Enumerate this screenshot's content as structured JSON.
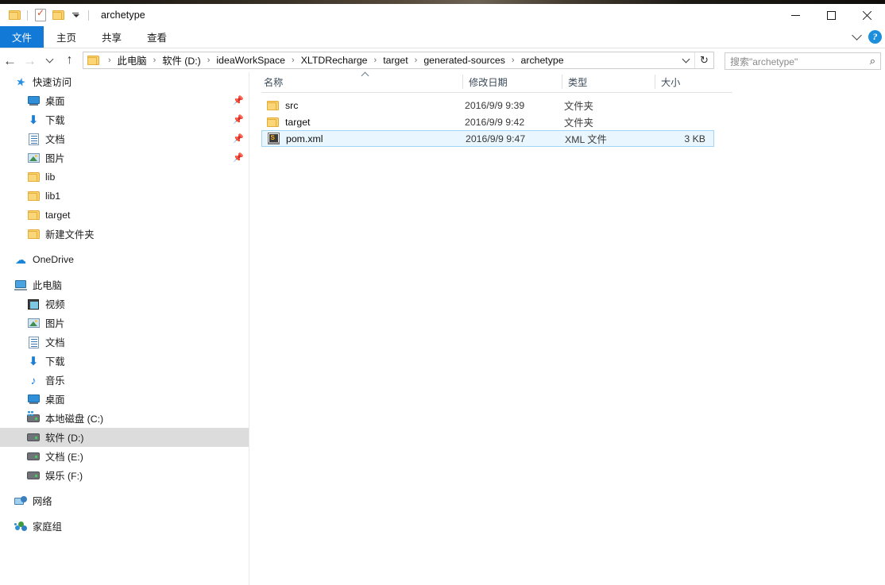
{
  "window": {
    "title": "archetype",
    "quick_access": [
      "folder-icon",
      "properties-checkdoc-icon",
      "new-folder-icon",
      "customize-dropdown-icon"
    ],
    "controls": {
      "minimize": "minimize-icon",
      "maximize": "maximize-icon",
      "close": "close-icon"
    }
  },
  "ribbon": {
    "tabs": [
      {
        "label": "文件",
        "active": true
      },
      {
        "label": "主页",
        "active": false
      },
      {
        "label": "共享",
        "active": false
      },
      {
        "label": "查看",
        "active": false
      }
    ],
    "collapse_icon": "chevron-down-icon",
    "help_icon": "help-icon",
    "help_glyph": "?"
  },
  "address": {
    "back_glyph": "←",
    "forward_glyph": "→",
    "recent_glyph": "recent-locations-icon",
    "up_glyph": "↑",
    "separator": "›",
    "breadcrumbs": [
      "此电脑",
      "软件 (D:)",
      "ideaWorkSpace",
      "XLTDRecharge",
      "target",
      "generated-sources",
      "archetype"
    ],
    "dropdown_icon": "address-dropdown-icon",
    "refresh_glyph": "↻"
  },
  "search": {
    "placeholder": "搜索\"archetype\"",
    "icon_glyph": "⌕"
  },
  "sidebar": {
    "items": [
      {
        "label": "快速访问",
        "icon": "star-pin-icon",
        "indent": 0,
        "pinned": false,
        "selected": false,
        "group": true
      },
      {
        "label": "桌面",
        "icon": "desktop-icon",
        "indent": 1,
        "pinned": true,
        "selected": false
      },
      {
        "label": "下载",
        "icon": "download-icon",
        "indent": 1,
        "pinned": true,
        "selected": false
      },
      {
        "label": "文档",
        "icon": "document-icon",
        "indent": 1,
        "pinned": true,
        "selected": false
      },
      {
        "label": "图片",
        "icon": "pictures-icon",
        "indent": 1,
        "pinned": true,
        "selected": false
      },
      {
        "label": "lib",
        "icon": "folder-icon",
        "indent": 1,
        "pinned": false,
        "selected": false
      },
      {
        "label": "lib1",
        "icon": "folder-icon",
        "indent": 1,
        "pinned": false,
        "selected": false
      },
      {
        "label": "target",
        "icon": "folder-icon",
        "indent": 1,
        "pinned": false,
        "selected": false
      },
      {
        "label": "新建文件夹",
        "icon": "folder-icon",
        "indent": 1,
        "pinned": false,
        "selected": false
      },
      {
        "label": "OneDrive",
        "icon": "onedrive-cloud-icon",
        "indent": 0,
        "pinned": false,
        "selected": false,
        "group": true,
        "spacer_before": true
      },
      {
        "label": "此电脑",
        "icon": "this-pc-icon",
        "indent": 0,
        "pinned": false,
        "selected": false,
        "group": true,
        "spacer_before": true
      },
      {
        "label": "视频",
        "icon": "video-icon",
        "indent": 1,
        "pinned": false,
        "selected": false
      },
      {
        "label": "图片",
        "icon": "pictures-icon",
        "indent": 1,
        "pinned": false,
        "selected": false
      },
      {
        "label": "文档",
        "icon": "document-icon",
        "indent": 1,
        "pinned": false,
        "selected": false
      },
      {
        "label": "下载",
        "icon": "download-icon",
        "indent": 1,
        "pinned": false,
        "selected": false
      },
      {
        "label": "音乐",
        "icon": "music-icon",
        "indent": 1,
        "pinned": false,
        "selected": false
      },
      {
        "label": "桌面",
        "icon": "desktop-icon",
        "indent": 1,
        "pinned": false,
        "selected": false
      },
      {
        "label": "本地磁盘 (C:)",
        "icon": "system-drive-icon",
        "indent": 1,
        "pinned": false,
        "selected": false
      },
      {
        "label": "软件 (D:)",
        "icon": "drive-icon",
        "indent": 1,
        "pinned": false,
        "selected": true
      },
      {
        "label": "文档 (E:)",
        "icon": "drive-icon",
        "indent": 1,
        "pinned": false,
        "selected": false
      },
      {
        "label": "娱乐 (F:)",
        "icon": "drive-icon",
        "indent": 1,
        "pinned": false,
        "selected": false
      },
      {
        "label": "网络",
        "icon": "network-icon",
        "indent": 0,
        "pinned": false,
        "selected": false,
        "group": true,
        "spacer_before": true
      },
      {
        "label": "家庭组",
        "icon": "homegroup-icon",
        "indent": 0,
        "pinned": false,
        "selected": false,
        "group": true,
        "spacer_before": true
      }
    ]
  },
  "filelist": {
    "columns": [
      {
        "label": "名称",
        "key": "name",
        "sorted": "asc"
      },
      {
        "label": "修改日期",
        "key": "date",
        "sorted": null
      },
      {
        "label": "类型",
        "key": "type",
        "sorted": null
      },
      {
        "label": "大小",
        "key": "size",
        "sorted": null
      }
    ],
    "rows": [
      {
        "name": "src",
        "date": "2016/9/9 9:39",
        "type": "文件夹",
        "size": "",
        "icon": "folder-icon",
        "selected": false
      },
      {
        "name": "target",
        "date": "2016/9/9 9:42",
        "type": "文件夹",
        "size": "",
        "icon": "folder-icon",
        "selected": false
      },
      {
        "name": "pom.xml",
        "date": "2016/9/9 9:47",
        "type": "XML 文件",
        "size": "3 KB",
        "icon": "xml-file-icon",
        "selected": true
      }
    ]
  },
  "colors": {
    "accent": "#1379d6",
    "selection_fill": "#eaf6fd",
    "selection_border": "#9fd6f5",
    "sidebar_selection": "#dcdcdc",
    "folder_yellow": "#fbd679",
    "header_text": "#3b4a5a"
  }
}
